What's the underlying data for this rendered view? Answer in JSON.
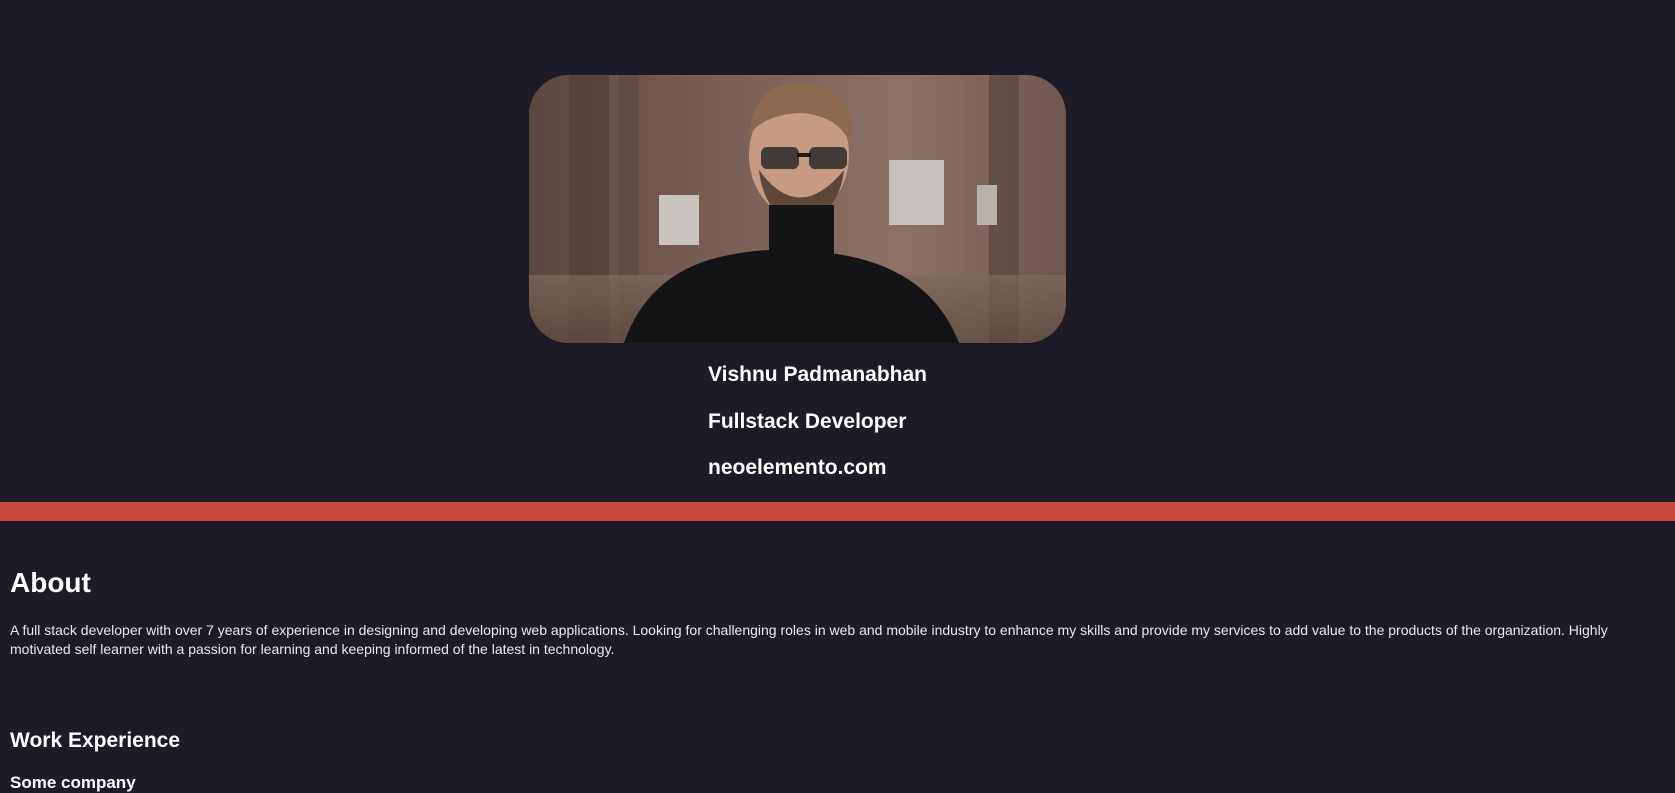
{
  "profile": {
    "photo_alt": "profile photo",
    "name": "Vishnu Padmanabhan",
    "role": "Fullstack Developer",
    "website": "neoelemento.com"
  },
  "about": {
    "title": "About",
    "text": "A full stack developer with over 7 years of experience in designing and developing web applications. Looking for challenging roles in web and mobile industry to enhance my skills and provide my services to add value to the products of the organization. Highly motivated self learner with a passion for learning and keeping informed of the latest in technology."
  },
  "work": {
    "title": "Work Experience",
    "company": "Some company"
  },
  "colors": {
    "background": "#1c1b26",
    "accent": "#c8493a",
    "text": "#ffffff"
  }
}
